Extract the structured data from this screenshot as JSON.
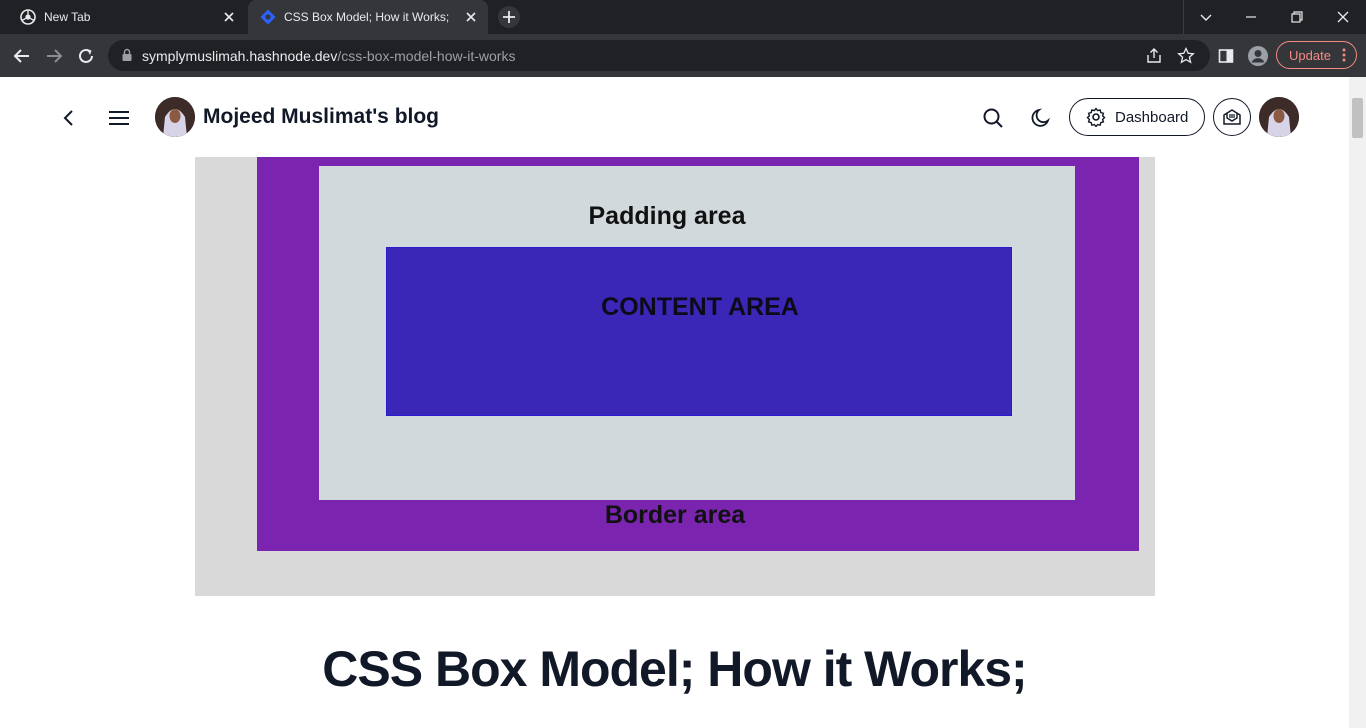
{
  "browser": {
    "tabs": [
      {
        "title": "New Tab",
        "active": false
      },
      {
        "title": "CSS Box Model; How it Works;",
        "active": true
      }
    ],
    "url_host": "symplymuslimah.hashnode.dev",
    "url_path": "/css-box-model-how-it-works",
    "update_label": "Update"
  },
  "blog": {
    "title": "Mojeed Muslimat's blog",
    "dashboard_label": "Dashboard"
  },
  "cover": {
    "padding_label": "Padding area",
    "content_label": "CONTENT AREA",
    "border_label": "Border area"
  },
  "post": {
    "title": "CSS Box Model; How it Works;"
  },
  "colors": {
    "border_area": "#7b24b0",
    "padding_area": "#d1d9dc",
    "content_area": "#3a27b8",
    "update_accent": "#f28b82"
  },
  "icons": [
    "chrome-icon",
    "hashnode-icon",
    "close-icon",
    "plus-icon",
    "chevron-down-icon",
    "minimize-icon",
    "restore-icon",
    "back-arrow-icon",
    "forward-arrow-icon",
    "reload-icon",
    "lock-icon",
    "share-icon",
    "star-icon",
    "sidepanel-icon",
    "profile-icon",
    "kebab-icon",
    "chevron-left-icon",
    "hamburger-icon",
    "search-icon",
    "moon-icon",
    "gear-icon",
    "newsletter-icon"
  ]
}
